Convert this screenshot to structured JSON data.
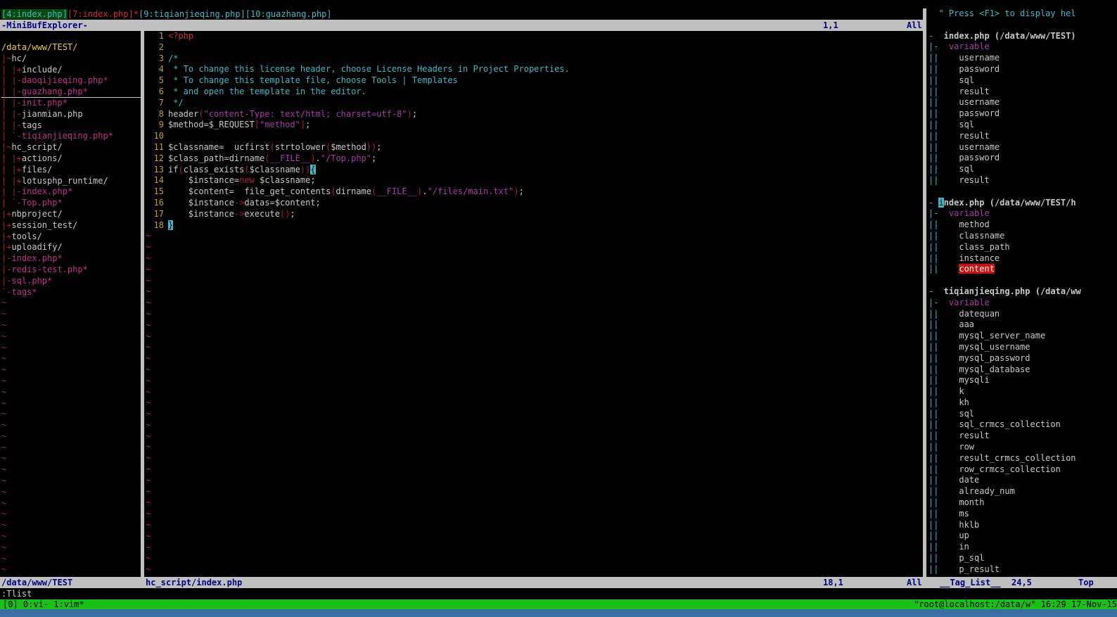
{
  "minibuf": {
    "tabs": [
      {
        "text": "[4:index.php]",
        "color": "#40b8c8",
        "active": true
      },
      {
        "text": "[7:index.php]*",
        "color": "#d02a3a",
        "active": false
      },
      {
        "text": "[9:tiqianjieqing.php]",
        "color": "#40b8c8",
        "active": false
      },
      {
        "text": "[10:guazhang.php]",
        "color": "#40b8c8",
        "active": false
      }
    ],
    "status_name": "-MiniBufExplorer-",
    "status_pos": "1,1",
    "status_pct": "All"
  },
  "tree": {
    "lines": [
      {
        "text": "/data/www/TEST/",
        "cls": "t-root"
      },
      {
        "text": "|~hc/",
        "cls": "t-dir"
      },
      {
        "text": "| |+include/",
        "cls": "t-dir"
      },
      {
        "text": "| |-daoqijieqing.php*",
        "cls": "t-mod"
      },
      {
        "text": "| |-guazhang.php*",
        "cls": "t-mod"
      },
      {
        "text": "| |-init.php*",
        "cls": "t-mod"
      },
      {
        "text": "| |-jianmian.php",
        "cls": "t-file"
      },
      {
        "text": "| |-tags",
        "cls": "t-file"
      },
      {
        "text": "| `-tiqianjieqing.php*",
        "cls": "t-mod"
      },
      {
        "text": "|~hc_script/",
        "cls": "t-dir"
      },
      {
        "text": "| |+actions/",
        "cls": "t-dir"
      },
      {
        "text": "| |+files/",
        "cls": "t-dir"
      },
      {
        "text": "| |+lotusphp_runtime/",
        "cls": "t-dir"
      },
      {
        "text": "| |-index.php*",
        "cls": "t-mod"
      },
      {
        "text": "| `-Top.php*",
        "cls": "t-mod"
      },
      {
        "text": "|+nbproject/",
        "cls": "t-dir"
      },
      {
        "text": "|+session_test/",
        "cls": "t-dir"
      },
      {
        "text": "|+tools/",
        "cls": "t-dir"
      },
      {
        "text": "|+uploadify/",
        "cls": "t-dir"
      },
      {
        "text": "|-index.php*",
        "cls": "t-mod"
      },
      {
        "text": "|-redis-test.php*",
        "cls": "t-mod"
      },
      {
        "text": "|-sql.php*",
        "cls": "t-mod"
      },
      {
        "text": "`-tags*",
        "cls": "t-mod"
      }
    ],
    "status": "/data/www/TEST"
  },
  "code": {
    "lines": [
      {
        "n": "1",
        "segs": [
          [
            "<?php",
            "c-kw"
          ]
        ]
      },
      {
        "n": "2",
        "segs": []
      },
      {
        "n": "3",
        "segs": [
          [
            "/*",
            "c-cm"
          ]
        ]
      },
      {
        "n": "4",
        "segs": [
          [
            " * To change this license header, choose License Headers in Project Properties.",
            "c-cm"
          ]
        ]
      },
      {
        "n": "5",
        "segs": [
          [
            " * To change this template file, choose Tools | Templates",
            "c-cm"
          ]
        ]
      },
      {
        "n": "6",
        "segs": [
          [
            " * and open the template in the editor.",
            "c-cm"
          ]
        ]
      },
      {
        "n": "7",
        "segs": [
          [
            " */",
            "c-cm"
          ]
        ]
      },
      {
        "n": "8",
        "segs": [
          [
            "header",
            "c-plain"
          ],
          [
            "(",
            "c-paren"
          ],
          [
            "\"content-Type: text/html; charset=utf-8\"",
            "c-str"
          ],
          [
            ")",
            "c-paren"
          ],
          [
            ";",
            "c-plain"
          ]
        ]
      },
      {
        "n": "9",
        "segs": [
          [
            "$method=$_REQUEST",
            "c-plain"
          ],
          [
            "[",
            "c-paren"
          ],
          [
            "\"method\"",
            "c-str"
          ],
          [
            "]",
            "c-paren"
          ],
          [
            ";",
            "c-plain"
          ]
        ]
      },
      {
        "n": "10",
        "segs": []
      },
      {
        "n": "11",
        "segs": [
          [
            "$classname=  ucfirst",
            "c-plain"
          ],
          [
            "(",
            "c-paren"
          ],
          [
            "strtolower",
            "c-plain"
          ],
          [
            "(",
            "c-paren"
          ],
          [
            "$method",
            "c-plain"
          ],
          [
            "))",
            "c-paren"
          ],
          [
            ";",
            "c-plain"
          ]
        ]
      },
      {
        "n": "12",
        "segs": [
          [
            "$class_path=dirname",
            "c-plain"
          ],
          [
            "(",
            "c-paren"
          ],
          [
            "__FILE__",
            "c-str"
          ],
          [
            ")",
            "c-paren"
          ],
          [
            ".",
            "c-plain"
          ],
          [
            "\"/Top.php\"",
            "c-str"
          ],
          [
            ";",
            "c-plain"
          ]
        ]
      },
      {
        "n": "13",
        "segs": [
          [
            "if",
            "c-plain"
          ],
          [
            "(",
            "c-paren"
          ],
          [
            "class_exists",
            "c-plain"
          ],
          [
            "(",
            "c-paren"
          ],
          [
            "$classname",
            "c-plain"
          ],
          [
            "))",
            "c-paren"
          ],
          [
            "{",
            "c-cur"
          ]
        ]
      },
      {
        "n": "14",
        "segs": [
          [
            "    $instance=",
            "c-plain"
          ],
          [
            "new",
            "c-new"
          ],
          [
            " $classname;",
            "c-plain"
          ]
        ]
      },
      {
        "n": "15",
        "segs": [
          [
            "    $content=  file_get_contents",
            "c-plain"
          ],
          [
            "(",
            "c-paren"
          ],
          [
            "dirname",
            "c-plain"
          ],
          [
            "(",
            "c-paren"
          ],
          [
            "__FILE__",
            "c-str"
          ],
          [
            ")",
            "c-paren"
          ],
          [
            ".",
            "c-plain"
          ],
          [
            "\"/files/main.txt\"",
            "c-str"
          ],
          [
            ")",
            "c-paren"
          ],
          [
            ";",
            "c-plain"
          ]
        ]
      },
      {
        "n": "16",
        "segs": [
          [
            "    $instance",
            "c-plain"
          ],
          [
            "->",
            "c-paren"
          ],
          [
            "datas=$content;",
            "c-plain"
          ]
        ]
      },
      {
        "n": "17",
        "segs": [
          [
            "    $instance",
            "c-plain"
          ],
          [
            "->",
            "c-paren"
          ],
          [
            "execute",
            "c-plain"
          ],
          [
            "()",
            "c-paren"
          ],
          [
            ";",
            "c-plain"
          ]
        ]
      },
      {
        "n": "18",
        "segs": [
          [
            "}",
            "c-cur"
          ]
        ]
      }
    ],
    "status_file": "hc_script/index.php",
    "status_pos": "18,1",
    "status_pct": "All"
  },
  "taglist": {
    "lines": [
      {
        "fold": "",
        "text": "\" Press <F1> to display hel",
        "cls": "tl-help"
      },
      {
        "fold": "",
        "text": "",
        "cls": "tl-tag"
      },
      {
        "fold": "-",
        "text": " index.php (/data/www/TEST)",
        "cls": "tl-file"
      },
      {
        "fold": "|-",
        "text": "  variable",
        "cls": "tl-kind"
      },
      {
        "fold": "||",
        "text": "    username",
        "cls": "tl-tag"
      },
      {
        "fold": "||",
        "text": "    password",
        "cls": "tl-tag"
      },
      {
        "fold": "||",
        "text": "    sql",
        "cls": "tl-tag"
      },
      {
        "fold": "||",
        "text": "    result",
        "cls": "tl-tag"
      },
      {
        "fold": "||",
        "text": "    username",
        "cls": "tl-tag"
      },
      {
        "fold": "||",
        "text": "    password",
        "cls": "tl-tag"
      },
      {
        "fold": "||",
        "text": "    sql",
        "cls": "tl-tag"
      },
      {
        "fold": "||",
        "text": "    result",
        "cls": "tl-tag"
      },
      {
        "fold": "||",
        "text": "    username",
        "cls": "tl-tag"
      },
      {
        "fold": "||",
        "text": "    password",
        "cls": "tl-tag"
      },
      {
        "fold": "||",
        "text": "    sql",
        "cls": "tl-tag"
      },
      {
        "fold": "||",
        "text": "    result",
        "cls": "tl-tag"
      },
      {
        "fold": "",
        "text": "",
        "cls": "tl-tag"
      },
      {
        "fold": "-",
        "text": " index.php (/data/www/TEST/h",
        "cls": "tl-file",
        "cursor": true
      },
      {
        "fold": "|-",
        "text": "  variable",
        "cls": "tl-kind"
      },
      {
        "fold": "||",
        "text": "    method",
        "cls": "tl-tag"
      },
      {
        "fold": "||",
        "text": "    classname",
        "cls": "tl-tag"
      },
      {
        "fold": "||",
        "text": "    class_path",
        "cls": "tl-tag"
      },
      {
        "fold": "||",
        "text": "    instance",
        "cls": "tl-tag"
      },
      {
        "fold": "||",
        "text": "    content",
        "cls": "tl-tag",
        "highlight": true
      },
      {
        "fold": "",
        "text": "",
        "cls": "tl-tag"
      },
      {
        "fold": "-",
        "text": " tiqianjieqing.php (/data/ww",
        "cls": "tl-file"
      },
      {
        "fold": "|-",
        "text": "  variable",
        "cls": "tl-kind"
      },
      {
        "fold": "||",
        "text": "    datequan",
        "cls": "tl-tag"
      },
      {
        "fold": "||",
        "text": "    aaa",
        "cls": "tl-tag"
      },
      {
        "fold": "||",
        "text": "    mysql_server_name",
        "cls": "tl-tag"
      },
      {
        "fold": "||",
        "text": "    mysql_username",
        "cls": "tl-tag"
      },
      {
        "fold": "||",
        "text": "    mysql_password",
        "cls": "tl-tag"
      },
      {
        "fold": "||",
        "text": "    mysql_database",
        "cls": "tl-tag"
      },
      {
        "fold": "||",
        "text": "    mysqli",
        "cls": "tl-tag"
      },
      {
        "fold": "||",
        "text": "    k",
        "cls": "tl-tag"
      },
      {
        "fold": "||",
        "text": "    kh",
        "cls": "tl-tag"
      },
      {
        "fold": "||",
        "text": "    sql",
        "cls": "tl-tag"
      },
      {
        "fold": "||",
        "text": "    sql_crmcs_collection",
        "cls": "tl-tag"
      },
      {
        "fold": "||",
        "text": "    result",
        "cls": "tl-tag"
      },
      {
        "fold": "||",
        "text": "    row",
        "cls": "tl-tag"
      },
      {
        "fold": "||",
        "text": "    result_crmcs_collection",
        "cls": "tl-tag"
      },
      {
        "fold": "||",
        "text": "    row_crmcs_collection",
        "cls": "tl-tag"
      },
      {
        "fold": "||",
        "text": "    date",
        "cls": "tl-tag"
      },
      {
        "fold": "||",
        "text": "    already_num",
        "cls": "tl-tag"
      },
      {
        "fold": "||",
        "text": "    month",
        "cls": "tl-tag"
      },
      {
        "fold": "||",
        "text": "    ms",
        "cls": "tl-tag"
      },
      {
        "fold": "||",
        "text": "    hklb",
        "cls": "tl-tag"
      },
      {
        "fold": "||",
        "text": "    up",
        "cls": "tl-tag"
      },
      {
        "fold": "||",
        "text": "    in",
        "cls": "tl-tag"
      },
      {
        "fold": "||",
        "text": "    p_sql",
        "cls": "tl-tag"
      },
      {
        "fold": "||",
        "text": "    p_result",
        "cls": "tl-tag"
      }
    ],
    "status_name": "__Tag_List__",
    "status_pos": "24,5",
    "status_pct": "Top"
  },
  "cmdline": ":Tlist",
  "tmux": {
    "left": "[0] 0:vi- 1:vim*",
    "right": "\"root@localhost:/data/w\" 16:29 17-Nov-15"
  },
  "colors": {
    "status_bg": "#c0c0c0",
    "status_fg": "#000080",
    "tmux_bg": "#18c018",
    "highlight": "#d01010",
    "cursor": "#40b8c8"
  }
}
